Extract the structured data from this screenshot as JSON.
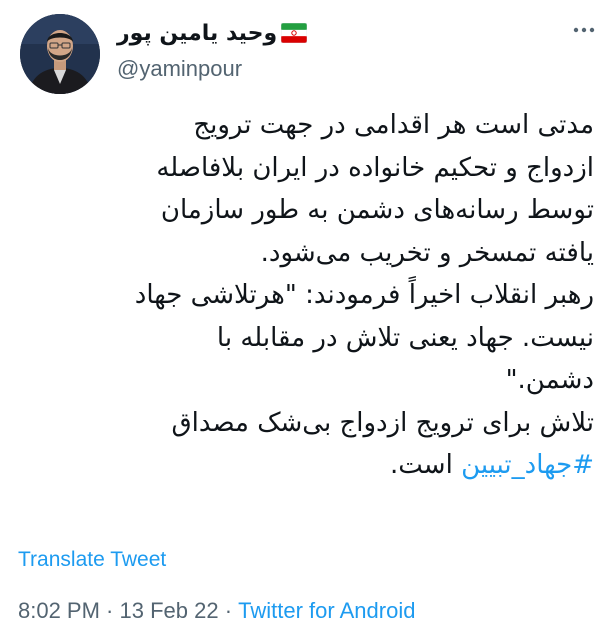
{
  "author": {
    "display_name": "وحید یامین پور",
    "flag_icon": "iran-flag-icon",
    "handle": "@yaminpour",
    "avatar_icon": "profile-photo"
  },
  "menu": {
    "icon": "more-options-icon"
  },
  "tweet": {
    "lines": [
      "مدتی است هر اقدامی در جهت ترویج",
      "ازدواج و تحکیم خانواده در ایران بلافاصله",
      "توسط رسانه‌های دشمن به طور سازمان",
      "یافته تمسخر و تخریب می‌شود.",
      "رهبر انقلاب اخیراً فرمودند: \"هرتلاشی جهاد",
      "نیست. جهاد یعنی تلاش در مقابله با",
      "دشمن.\"",
      "تلاش برای ترویج ازدواج بی‌شک مصداق"
    ],
    "hashtag": "#جهاد_تبیین",
    "last_line_tail": " است."
  },
  "footer": {
    "translate_label": "Translate Tweet",
    "time": "8:02 PM",
    "separator1": " · ",
    "date": "13 Feb 22",
    "separator2": " · ",
    "source": "Twitter for Android"
  },
  "colors": {
    "link": "#1d9bf0",
    "muted": "#536471",
    "text": "#0f1419"
  }
}
